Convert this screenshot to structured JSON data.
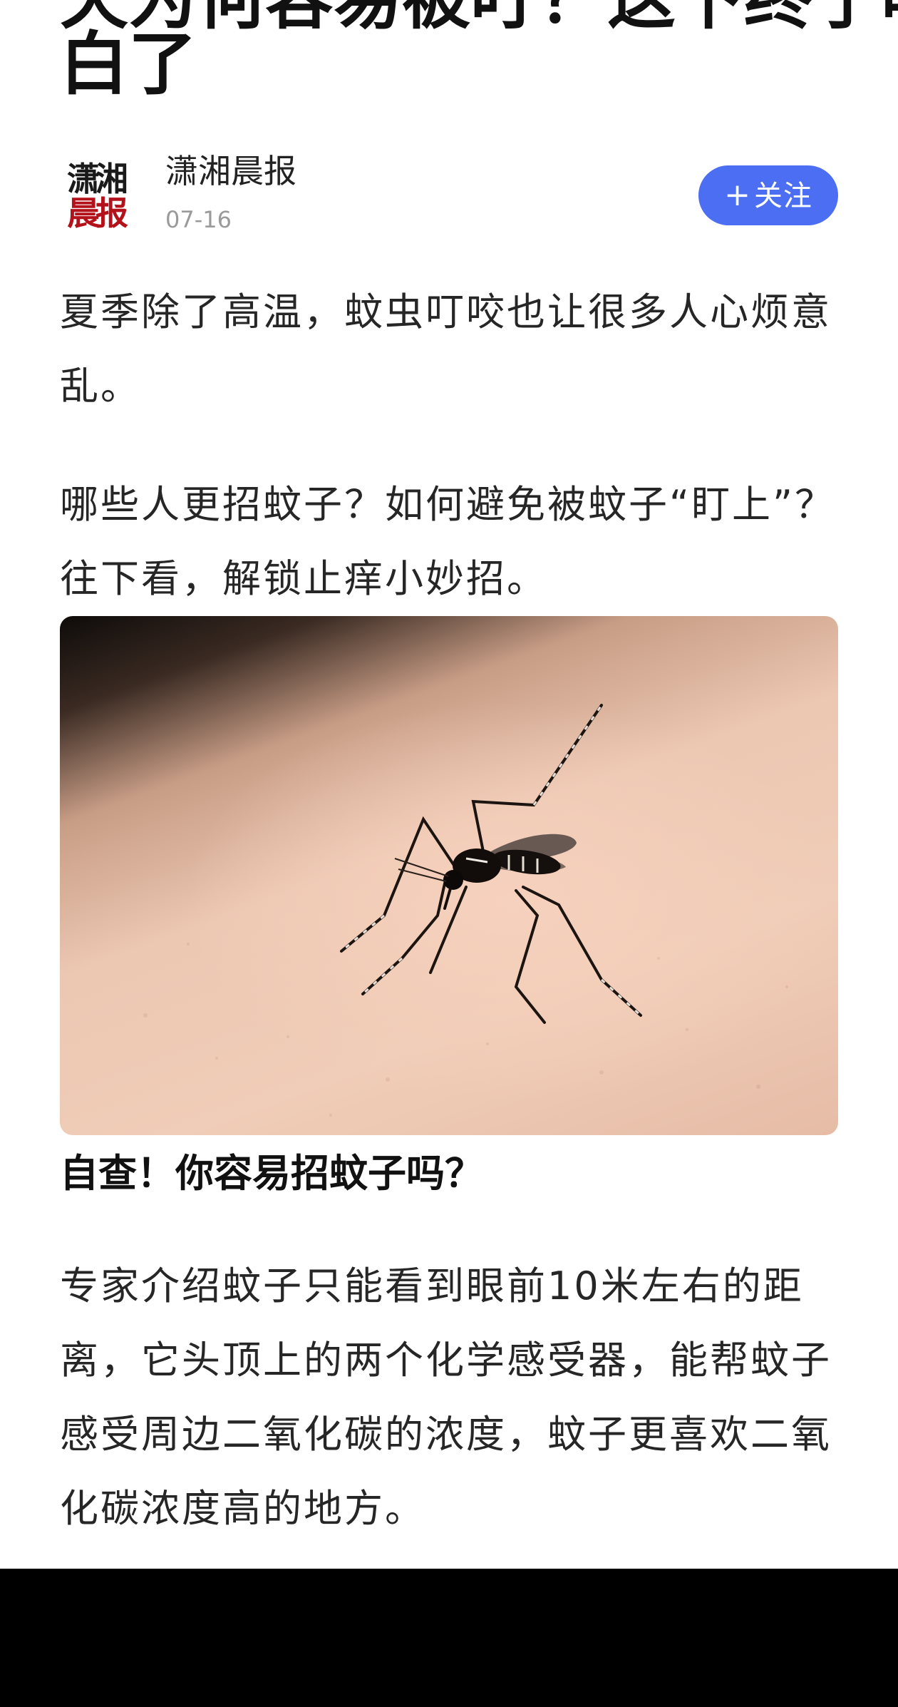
{
  "article": {
    "title_line1": "天为何容易被叮？这下终于明",
    "title_line2": "白了",
    "author": {
      "logo_line1": "潇湘",
      "logo_line2": "晨报",
      "name": "潇湘晨报",
      "date": "07-16"
    },
    "follow_plus": "+",
    "follow_label": "关注",
    "paragraph1": "夏季除了高温，蚊虫叮咬也让很多人心烦意乱。",
    "paragraph2": "哪些人更招蚊子？如何避免被蚊子“盯上”？往下看，解锁止痒小妙招。",
    "subheading": "自查！你容易招蚊子吗？",
    "paragraph3": "专家介绍蚊子只能看到眼前10米左右的距离，它头顶上的两个化学感受器，能帮蚊子感受周边二氧化碳的浓度，蚊子更喜欢二氧化碳浓度高的地方。"
  },
  "colors": {
    "follow_button": "#4b6ef3",
    "logo_accent": "#b4121b",
    "bottom_bar": "#000000"
  }
}
